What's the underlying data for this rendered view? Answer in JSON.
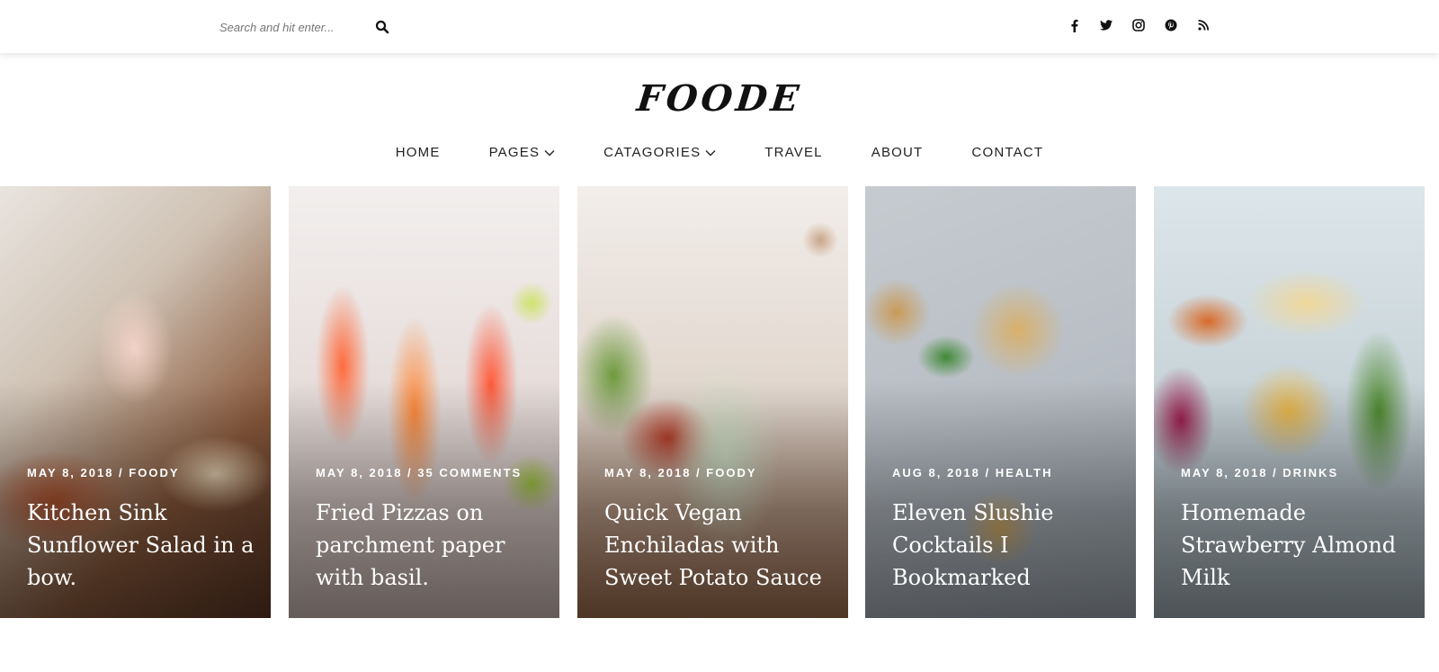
{
  "search": {
    "placeholder": "Search and hit enter..."
  },
  "icons": {
    "search": "search-icon",
    "social": [
      "facebook-icon",
      "twitter-icon",
      "instagram-icon",
      "pinterest-icon",
      "rss-icon"
    ]
  },
  "logo": {
    "text": "FOODE"
  },
  "nav": {
    "items": [
      {
        "label": "HOME"
      },
      {
        "label": "PAGES"
      },
      {
        "label": "CATAGORIES"
      },
      {
        "label": "TRAVEL"
      },
      {
        "label": "ABOUT"
      },
      {
        "label": "CONTACT"
      }
    ]
  },
  "cards": [
    {
      "meta": "MAY 8, 2018 / FOODY",
      "title": "Kitchen Sink Sunflower Salad in a bow."
    },
    {
      "meta": "MAY 8, 2018 / 35 COMMENTS",
      "title": "Fried Pizzas on parchment paper with basil."
    },
    {
      "meta": "MAY 8, 2018 / FOODY",
      "title": "Quick Vegan Enchiladas with Sweet Potato Sauce"
    },
    {
      "meta": "AUG 8, 2018 / HEALTH",
      "title": "Eleven Slushie Cocktails I Bookmarked"
    },
    {
      "meta": "MAY 8, 2018 / DRINKS",
      "title": "Homemade Strawberry Almond Milk"
    }
  ]
}
